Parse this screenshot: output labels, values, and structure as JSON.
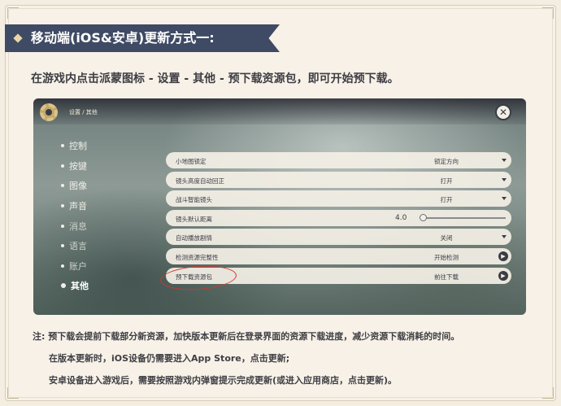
{
  "banner": {
    "title": "移动端(iOS&安卓)更新方式一:"
  },
  "subtitle": "在游戏内点击派蒙图标 - 设置 - 其他 - 预下载资源包，即可开始预下载。",
  "game": {
    "breadcrumb": "设置 / 其他",
    "sidebar": {
      "items": [
        {
          "label": "控制"
        },
        {
          "label": "按键"
        },
        {
          "label": "图像"
        },
        {
          "label": "声音"
        },
        {
          "label": "消息"
        },
        {
          "label": "语言"
        },
        {
          "label": "账户"
        },
        {
          "label": "其他"
        }
      ]
    },
    "rows": [
      {
        "label": "小地图锁定",
        "value": "锁定方向"
      },
      {
        "label": "镜头高度自动回正",
        "value": "打开"
      },
      {
        "label": "战斗智能镜头",
        "value": "打开"
      },
      {
        "label": "镜头默认距离",
        "value": "4.0",
        "slider_fraction": 0.0
      },
      {
        "label": "自动播放剧情",
        "value": "关闭"
      },
      {
        "label": "检测资源完整性",
        "value": "开始检测"
      },
      {
        "label": "预下载资源包",
        "value": "前往下载"
      }
    ]
  },
  "notes": [
    "注: 预下载会提前下载部分新资源，加快版本更新后在登录界面的资源下载进度，减少资源下载消耗的时间。",
    "在版本更新时，iOS设备仍需要进入App Store，点击更新;",
    "安卓设备进入游戏后，需要按照游戏内弹窗提示完成更新(或进入应用商店，点击更新)。"
  ],
  "colors": {
    "banner": "#3f4a64",
    "highlight": "#c93a35",
    "page": "#f3ede2"
  }
}
